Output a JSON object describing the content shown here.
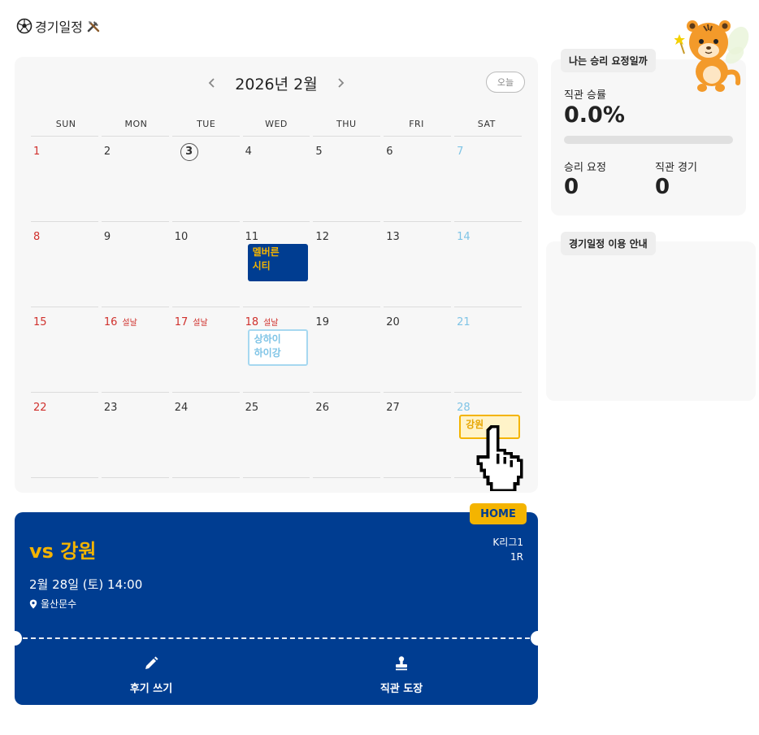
{
  "page": {
    "title": "경기일정"
  },
  "calendar": {
    "month_label": "2026년 2월",
    "today_label": "오늘",
    "weekdays": [
      "SUN",
      "MON",
      "TUE",
      "WED",
      "THU",
      "FRI",
      "SAT"
    ],
    "days": [
      {
        "d": "1"
      },
      {
        "d": "2"
      },
      {
        "d": "3"
      },
      {
        "d": "4"
      },
      {
        "d": "5"
      },
      {
        "d": "6"
      },
      {
        "d": "7"
      },
      {
        "d": "8"
      },
      {
        "d": "9"
      },
      {
        "d": "10"
      },
      {
        "d": "11",
        "event": "멜버른\n시티"
      },
      {
        "d": "12"
      },
      {
        "d": "13"
      },
      {
        "d": "14"
      },
      {
        "d": "15"
      },
      {
        "d": "16",
        "holiday": "설날"
      },
      {
        "d": "17",
        "holiday": "설날"
      },
      {
        "d": "18",
        "holiday": "설날",
        "event": "상하이\n하이강"
      },
      {
        "d": "19"
      },
      {
        "d": "20"
      },
      {
        "d": "21"
      },
      {
        "d": "22"
      },
      {
        "d": "23"
      },
      {
        "d": "24"
      },
      {
        "d": "25"
      },
      {
        "d": "26"
      },
      {
        "d": "27"
      },
      {
        "d": "28",
        "event": "강원"
      }
    ],
    "today": "3"
  },
  "match": {
    "home_label": "HOME",
    "opponent": "vs 강원",
    "league": "K리그1",
    "round": "1R",
    "datetime": "2월 28일 (토) 14:00",
    "venue": "울산문수",
    "review_label": "후기 쓰기",
    "stamp_label": "직관 도장"
  },
  "stats": {
    "tab_label": "나는 승리 요정일까",
    "rate_label": "직관 승률",
    "rate_value": "0.0%",
    "rate_fraction": 0.0,
    "win_label": "승리 요정",
    "win_value": "0",
    "games_label": "직관 경기",
    "games_value": "0"
  },
  "guide": {
    "tab_label": "경기일정 이용 안내"
  },
  "colors": {
    "navy": "#003d91",
    "gold": "#f4b400",
    "sunday": "#d0312d",
    "saturday": "#7fc4e6"
  }
}
